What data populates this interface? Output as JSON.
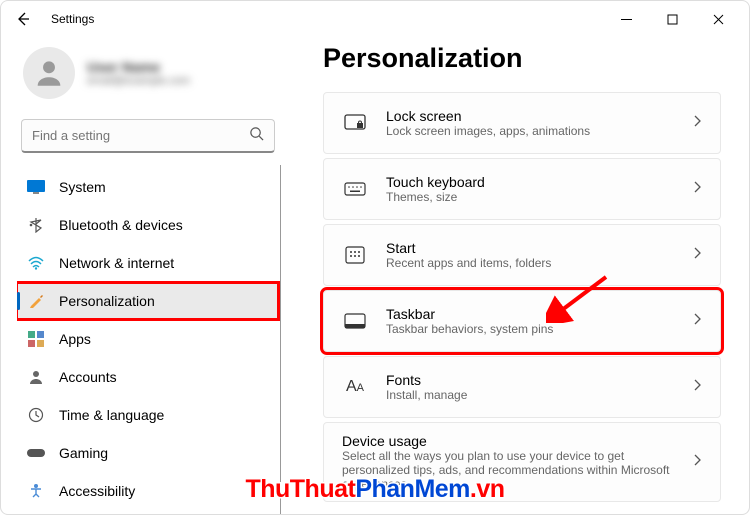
{
  "window": {
    "title": "Settings"
  },
  "profile": {
    "name": "User Name",
    "email": "email@example.com"
  },
  "search": {
    "placeholder": "Find a setting"
  },
  "nav": [
    {
      "key": "system",
      "label": "System"
    },
    {
      "key": "bluetooth",
      "label": "Bluetooth & devices"
    },
    {
      "key": "network",
      "label": "Network & internet"
    },
    {
      "key": "personalization",
      "label": "Personalization"
    },
    {
      "key": "apps",
      "label": "Apps"
    },
    {
      "key": "accounts",
      "label": "Accounts"
    },
    {
      "key": "time",
      "label": "Time & language"
    },
    {
      "key": "gaming",
      "label": "Gaming"
    },
    {
      "key": "accessibility",
      "label": "Accessibility"
    }
  ],
  "page": {
    "title": "Personalization"
  },
  "cards": [
    {
      "key": "lockscreen",
      "title": "Lock screen",
      "sub": "Lock screen images, apps, animations"
    },
    {
      "key": "touchkeyboard",
      "title": "Touch keyboard",
      "sub": "Themes, size"
    },
    {
      "key": "start",
      "title": "Start",
      "sub": "Recent apps and items, folders"
    },
    {
      "key": "taskbar",
      "title": "Taskbar",
      "sub": "Taskbar behaviors, system pins"
    },
    {
      "key": "fonts",
      "title": "Fonts",
      "sub": "Install, manage"
    },
    {
      "key": "deviceusage",
      "title": "Device usage",
      "sub": "Select all the ways you plan to use your device to get personalized tips, ads, and recommendations within Microsoft experiences."
    }
  ],
  "watermark": {
    "a": "ThuThuat",
    "b": "PhanMem",
    "c": ".vn"
  }
}
